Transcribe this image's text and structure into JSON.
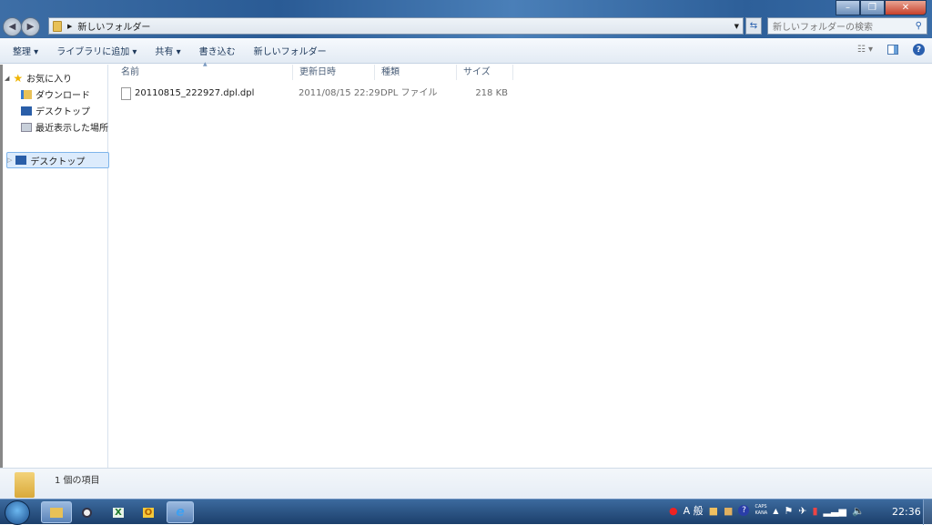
{
  "window": {
    "minimize": "–",
    "maximize": "❐",
    "close": "✕"
  },
  "address": {
    "breadcrumb": "新しいフォルダー",
    "search_placeholder": "新しいフォルダーの検索"
  },
  "toolbar": {
    "organize": "整理 ▾",
    "add_library": "ライブラリに追加 ▾",
    "share": "共有 ▾",
    "burn": "書き込む",
    "new_folder": "新しいフォルダー"
  },
  "nav": {
    "favorites": "お気に入り",
    "downloads": "ダウンロード",
    "desktop_fav": "デスクトップ",
    "recent": "最近表示した場所",
    "desktop": "デスクトップ"
  },
  "columns": [
    "名前",
    "更新日時",
    "種類",
    "サイズ"
  ],
  "files": [
    {
      "name": "20110815_222927.dpl.dpl",
      "modified": "2011/08/15 22:29",
      "type": "DPL ファイル",
      "size": "218 KB"
    }
  ],
  "status": {
    "count": "1 個の項目"
  },
  "taskbar": {
    "excel": "X",
    "outlook": "O",
    "ime_mode": "A 般",
    "caps": "CAPS",
    "kana": "KANA",
    "clock": "22:36"
  }
}
